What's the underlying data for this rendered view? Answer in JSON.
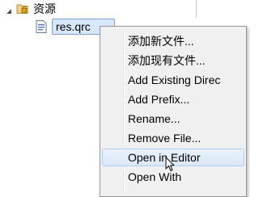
{
  "tree": {
    "folder_label": "资源",
    "file_label": "res.qrc"
  },
  "context_menu": {
    "items": [
      {
        "label": "添加新文件..."
      },
      {
        "label": "添加现有文件..."
      },
      {
        "label": "Add Existing Direc"
      },
      {
        "label": "Add Prefix..."
      },
      {
        "label": "Rename..."
      },
      {
        "label": "Remove File..."
      },
      {
        "label": "Open in Editor"
      },
      {
        "label": "Open With"
      }
    ],
    "hovered_item": "Open in Editor"
  },
  "colors": {
    "selection_bg": "#d8e7fb",
    "selection_border": "#7da2ce",
    "menu_bg": "#f0f0f0",
    "hover_border": "#aecff7"
  },
  "icons": {
    "folder": "folder-lock-icon",
    "file": "qrc-file-icon",
    "expand": "expanded-arrow-icon",
    "cursor": "mouse-pointer-icon"
  }
}
